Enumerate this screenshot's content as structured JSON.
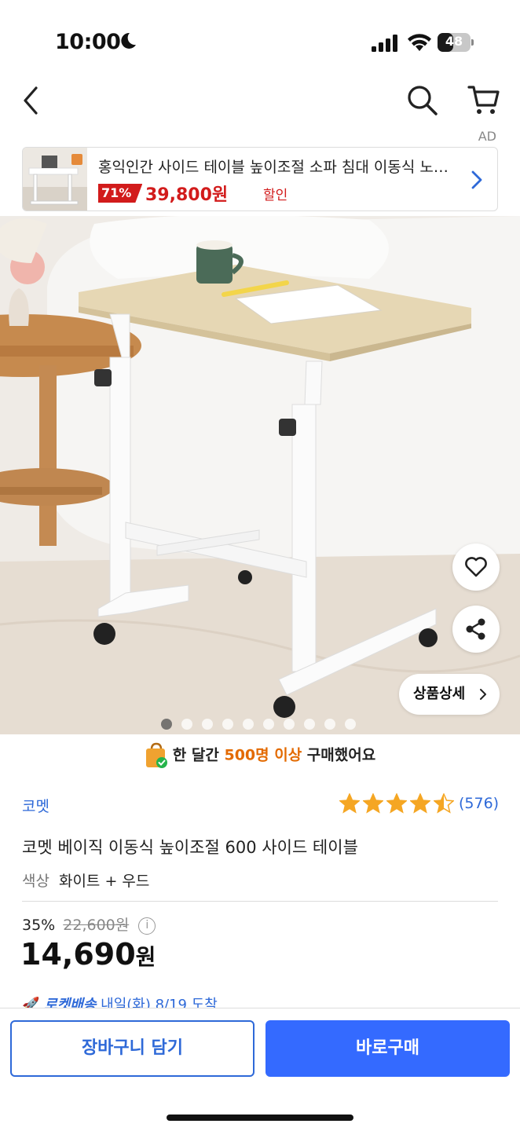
{
  "status_bar": {
    "time": "10:00",
    "battery": "48",
    "battery_level": 0.48,
    "icons": [
      "moon-icon",
      "signal-icon",
      "wifi-icon",
      "battery-icon"
    ]
  },
  "nav": {
    "icons": [
      "back-icon",
      "search-icon",
      "cart-icon"
    ]
  },
  "ad": {
    "tag": "AD",
    "title": "홍익인간 사이드 테이블 높이조절 소파 침대 이동식 노트북 테이블",
    "discount": "71%",
    "price": "39,800원",
    "sale_label": "할인"
  },
  "gallery": {
    "detail_button": "상품상세",
    "slide_count": 10,
    "active_slide": 1
  },
  "purchase_info": {
    "prefix": "한 달간 ",
    "highlight": "500명 이상",
    "suffix": " 구매했어요"
  },
  "product": {
    "brand": "코멧",
    "rating": 4.5,
    "review_count": "(576)",
    "title": "코멧 베이직 이동식 높이조절 600 사이드 테이블",
    "option_label": "색상",
    "option_value": "화이트 + 우드",
    "discount_rate": "35%",
    "original_price": "22,600원",
    "price_number": "14,690",
    "price_unit": "원",
    "delivery_badge": "로켓배송",
    "delivery_text": "내일(화) 8/19 도착"
  },
  "actions": {
    "add_to_cart": "장바구니 담기",
    "buy_now": "바로구매"
  },
  "colors": {
    "accent_blue": "#346aff",
    "link_blue": "#2e69d8",
    "sale_red": "#d21b1b",
    "highlight_orange": "#e36a00",
    "star": "#f5a623"
  }
}
